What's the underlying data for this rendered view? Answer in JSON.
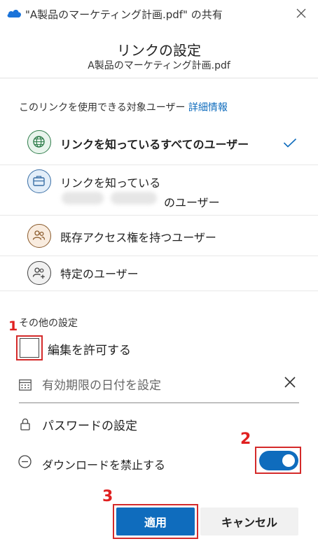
{
  "window": {
    "title": "\"A製品のマーケティング計画.pdf\" の共有",
    "icon": "onedrive-cloud-icon"
  },
  "header": {
    "title": "リンクの設定",
    "file_name": "A製品のマーケティング計画.pdf"
  },
  "audience": {
    "heading": "このリンクを使用できる対象ユーザー",
    "details_link": "詳細情報",
    "options": [
      {
        "label": "リンクを知っているすべてのユーザー",
        "icon": "globe-icon",
        "selected": true
      },
      {
        "label": "リンクを知っている",
        "label_line2": "のユーザー",
        "icon": "briefcase-icon",
        "selected": false
      },
      {
        "label": "既存アクセス権を持つユーザー",
        "icon": "people-icon",
        "selected": false
      },
      {
        "label": "特定のユーザー",
        "icon": "people-add-icon",
        "selected": false
      }
    ]
  },
  "other_settings": {
    "heading": "その他の設定",
    "allow_edit": {
      "label": "編集を許可する",
      "checked": false
    },
    "expiry": {
      "placeholder": "有効期限の日付を設定"
    },
    "password": {
      "label": "パスワードの設定"
    },
    "block_download": {
      "label": "ダウンロードを禁止する",
      "on": true
    }
  },
  "buttons": {
    "apply": "適用",
    "cancel": "キャンセル"
  },
  "annotations": {
    "marker1": "1",
    "marker2": "2",
    "marker3": "3"
  },
  "colors": {
    "accent": "#0f6cbd",
    "annotation_red": "#e02020"
  }
}
